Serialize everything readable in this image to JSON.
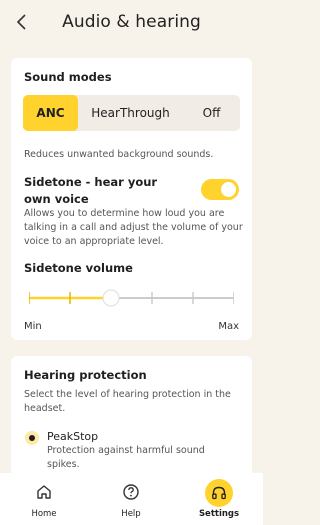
{
  "header": {
    "title": "Audio & hearing"
  },
  "sound_modes": {
    "title": "Sound modes",
    "options": [
      "ANC",
      "HearThrough",
      "Off"
    ],
    "selected": "ANC",
    "description": "Reduces unwanted background sounds."
  },
  "sidetone": {
    "title": "Sidetone - hear your own voice",
    "enabled": true,
    "description": "Allows you to determine how loud you are talking in a call and adjust the volume of your voice to an appropriate level."
  },
  "sidetone_volume": {
    "title": "Sidetone volume",
    "min_label": "Min",
    "max_label": "Max",
    "steps": 6,
    "value_step": 2
  },
  "hearing_protection": {
    "title": "Hearing protection",
    "description": "Select the level of hearing protection in the headset.",
    "options": [
      {
        "label": "PeakStop",
        "description": "Protection against harmful sound spikes.",
        "selected": true
      }
    ]
  },
  "bottom_nav": {
    "items": [
      {
        "label": "Home",
        "icon": "home-icon"
      },
      {
        "label": "Help",
        "icon": "help-icon"
      },
      {
        "label": "Settings",
        "icon": "headphones-icon",
        "active": true
      }
    ]
  },
  "colors": {
    "accent": "#ffd22e",
    "background": "#f7f2ea",
    "card": "#ffffff"
  }
}
